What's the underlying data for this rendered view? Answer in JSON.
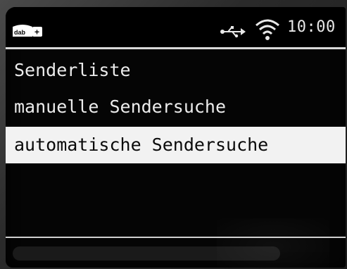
{
  "status_bar": {
    "logo_text": "dab+",
    "usb_icon": "usb-icon",
    "wifi_icon": "wifi-icon",
    "time": "10:00"
  },
  "menu": {
    "items": [
      {
        "label": "Senderliste",
        "selected": false
      },
      {
        "label": "manuelle Sendersuche",
        "selected": false
      },
      {
        "label": "automatische Sendersuche",
        "selected": true
      }
    ]
  },
  "colors": {
    "screen_bg": "#050505",
    "text": "#ececec",
    "highlight_bg": "#f2f2f2",
    "highlight_text": "#0a0a0a"
  }
}
